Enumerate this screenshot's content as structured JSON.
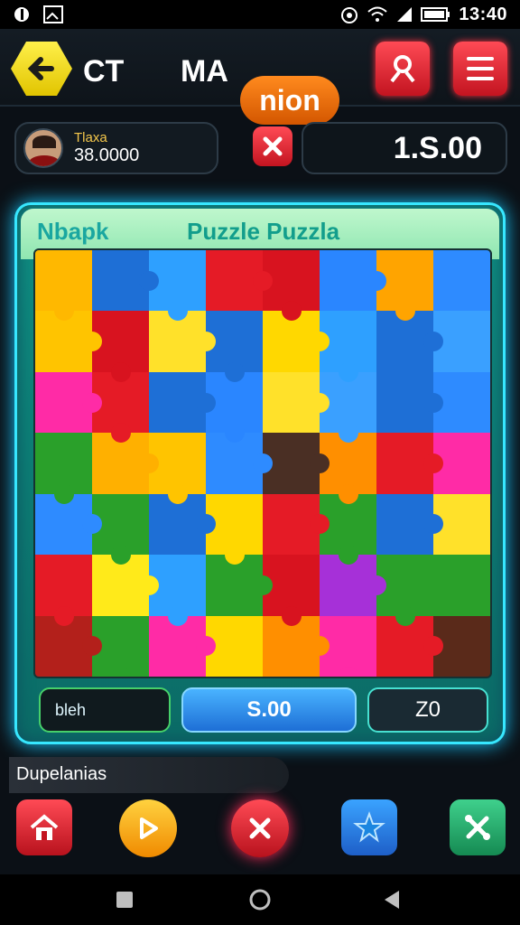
{
  "status_bar": {
    "time": "13:40"
  },
  "top_bar": {
    "code": "CT",
    "title_left": "MA",
    "title_right": "nion"
  },
  "player": {
    "name": "Tlaxa",
    "score": "38.0000"
  },
  "balance": "1.S.00",
  "panel": {
    "left_label": "Nbapk",
    "title": "Puzzle Puzzla",
    "buttons": {
      "left": "bleh",
      "center": "S.00",
      "right": "Z0"
    }
  },
  "section_label": "Dupelanias",
  "colors": {
    "accent_cyan": "#37e7ff",
    "accent_red": "#e51b26",
    "accent_yellow": "#ffd800",
    "blue": "#1e6fd6"
  },
  "icons": {
    "status_left": [
      "circle-icon",
      "image-icon"
    ],
    "status_right": [
      "alarm-icon",
      "wifi-icon",
      "signal-icon",
      "battery-icon"
    ],
    "top": [
      "back-arrow-icon",
      "user-icon",
      "menu-icon"
    ],
    "dock": [
      "home-icon",
      "play-icon",
      "close-icon",
      "star-icon",
      "tools-icon"
    ],
    "nav": [
      "square-icon",
      "home-circle-icon",
      "back-triangle-icon"
    ]
  }
}
